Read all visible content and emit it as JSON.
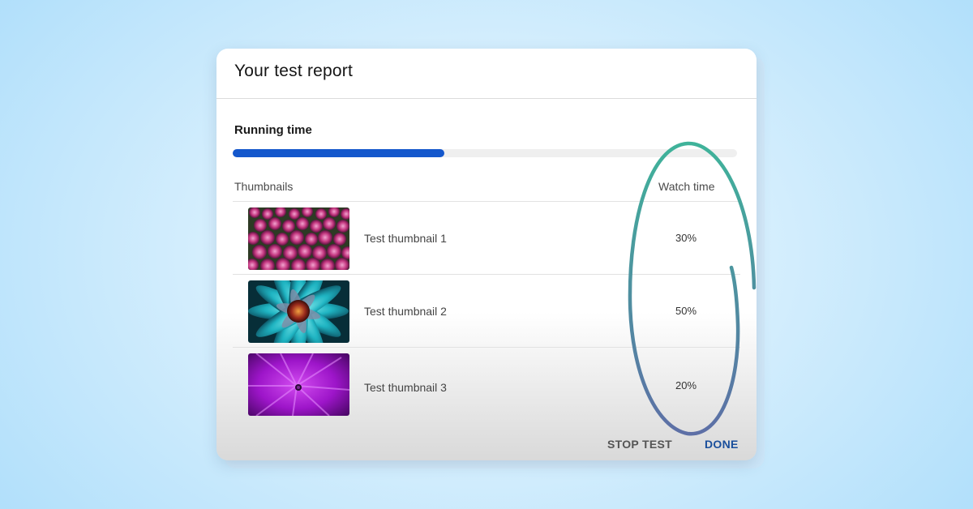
{
  "dialog": {
    "title": "Your test report",
    "running_time": {
      "label": "Running time",
      "progress_fraction": 0.42
    },
    "columns": {
      "thumbnails": "Thumbnails",
      "watch_time": "Watch time"
    },
    "rows": [
      {
        "label": "Test thumbnail 1",
        "watch_time": "30%",
        "image": "pink-flower-field-image"
      },
      {
        "label": "Test thumbnail 2",
        "watch_time": "50%",
        "image": "teal-flower-closeup-image"
      },
      {
        "label": "Test thumbnail 3",
        "watch_time": "20%",
        "image": "purple-flower-macro-image"
      }
    ],
    "actions": {
      "stop_test": "STOP TEST",
      "done": "DONE"
    }
  },
  "colors": {
    "progress_fill": "#1457cc",
    "done_button": "#1a4f9c",
    "annotation_gradient": [
      "#3fb39a",
      "#5d6fa6"
    ]
  }
}
